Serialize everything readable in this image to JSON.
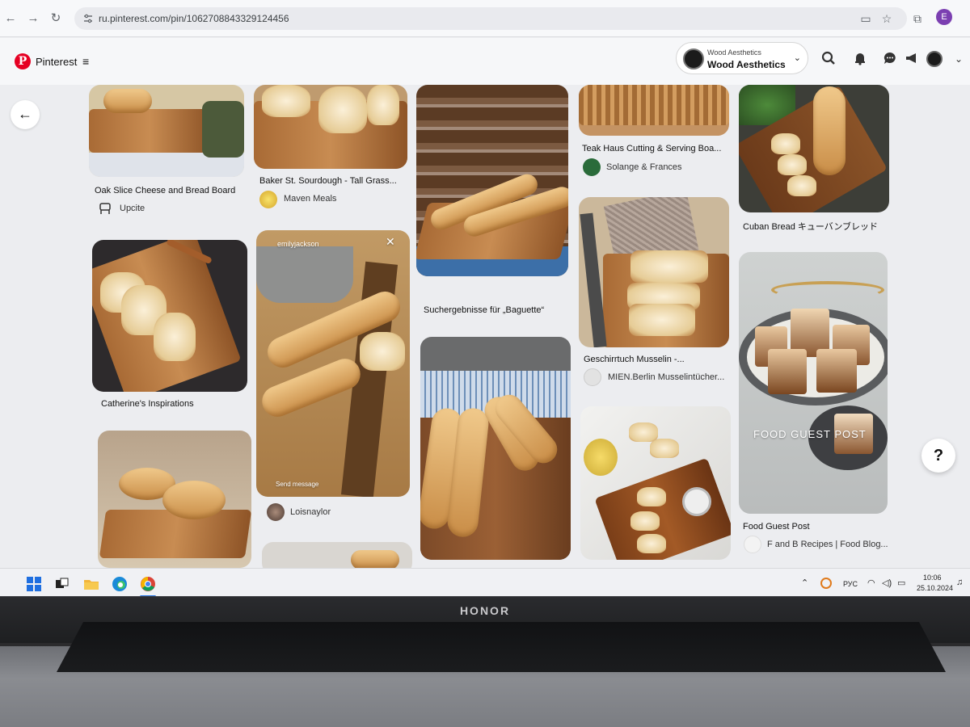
{
  "browser": {
    "url": "ru.pinterest.com/pin/1062708843329124456",
    "profile_initial": "E"
  },
  "header": {
    "logo_text": "Pinterest",
    "account_small": "Wood Aesthetics",
    "account_big": "Wood Aesthetics"
  },
  "pins": [
    {
      "title": "Oak Slice Cheese and Bread Board",
      "author": "Upcite"
    },
    {
      "title": "Baker St. Sourdough - Tall Grass...",
      "author": "Maven Meals"
    },
    {
      "title": "Suchergebnisse für „Baguette“"
    },
    {
      "title": "Teak Haus Cutting & Serving Boa...",
      "author": "Solange & Frances"
    },
    {
      "title": "Cuban Bread キューバンブレッド"
    },
    {
      "title": "Catherine's Inspirations"
    },
    {
      "author": "Loisnaylor",
      "overlay_user": "emilyjackson",
      "overlay_send": "Send message"
    },
    {
      "title": "Geschirrtuch Musselin -...",
      "author": "MIEN.Berlin Musselintücher..."
    },
    {
      "title": "Food Guest Post",
      "author": "F and B Recipes | Food Blog...",
      "overlay": "FOOD GUEST POST"
    }
  ],
  "taskbar": {
    "lang": "РУС",
    "time": "10:06",
    "date": "25.10.2024"
  },
  "device": {
    "brand": "HONOR"
  },
  "colors": {
    "pinterest_red": "#e60023",
    "taskbar_bg": "#f0f1f4"
  }
}
